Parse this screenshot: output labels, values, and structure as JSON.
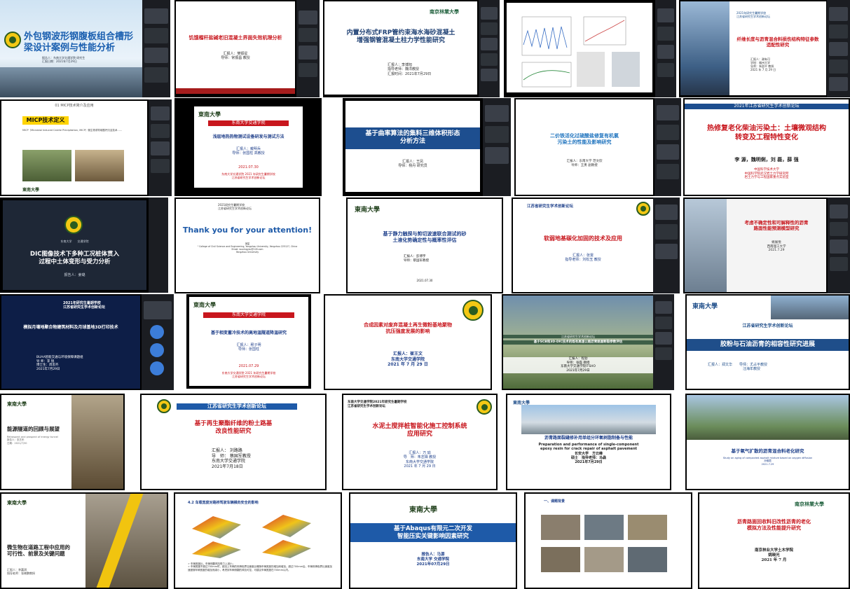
{
  "tiles": [
    {
      "title": "外包钢波形钢腹板组合槽形\n梁设计案例与性能分析",
      "sub": "报告人：东南大学交通学院 研究生\n汇报日期：2021年7月29日"
    },
    {
      "title": "饥饿榴杆盐碱老旧混凝土界面失效机理分析",
      "sub": "汇报人：樊振星\n导师：常振昌 教授"
    },
    {
      "title": "内置分布式FRP管约束海水海砂混凝土\n增强钢管混凝土柱力学性能研究",
      "sub": "汇报人：李博旭\n指导老师：魏洋教授\n汇报时间：2021年7月29日"
    },
    {
      "title": "",
      "sub": ""
    },
    {
      "title": "纤维长度与沥青混合料损伤结构特征参数\n适配性研究",
      "sub": "汇报人：谢有可\n学校：福州大学\n导师：朱劭平 教授\n2021 年 7 月 29 日",
      "head": "2021年研究生暑期学校\n江苏省研究生学术创新论坛"
    },
    {
      "title": "MICP技术定义",
      "sub": "01 MICP技术简介及应用",
      "body": "MICP（Microbial Induced Calcite Precipitation, MICP）微生物诱导碳酸钙沉淀技术……"
    },
    {
      "title": "浅层地热热物测试设备研发与测试方法",
      "sub": "汇报人：戴明兵\n导师：张国柱 高教授",
      "date": "2021.07.30",
      "org": "东南大学交通学院 2021 年研究生暑期学校\n江苏省研究生学术创新论坛",
      "head": "东南大学交通学院"
    },
    {
      "title": "基于曲率算法的集料三维体积形态\n分析方法",
      "sub": "汇报人：王凤\n导师：杨丹 研究员"
    },
    {
      "title": "二价铁活化过硫酸盐修复有机氯\n污染土的性能及影响研究",
      "sub": "汇报人：东南大学 范文欣\n导师：王勇 副教授"
    },
    {
      "title": "热修复老化柴油污染土：土壤微观结构\n转变及工程特性变化",
      "sub": "李 源，魏明俐，刘 磊，薛 强",
      "org": "中国科学技术大学\n中国科学院武汉岩土力学研究所\n岩土力学与工程国家重点实验室",
      "head": "2021年江苏省研究生学术创新论坛"
    },
    {
      "title": "DIC图像技术下多种工况桩体贯入\n过程中土体变形与受力分析",
      "sub": "报告人：姜璐",
      "head": "东南大学　　交通学院"
    },
    {
      "title": "Thank you for your attention!",
      "sub": "吴星\n¹ College of Civil Science and Engineering, Yangzhou University, Yangzhou 225127, China\nEmail: wuxingyzu@126.com\nYangzhou University",
      "head": "2021研究生暑期学校\n江苏省研究生学术创新论坛"
    },
    {
      "title": "基于静力触探与剪切波速联合测试的砂\n土液化势确定性与概率性评估",
      "sub": "汇报人：彭博宇\n导师：蔡国军教授",
      "date": "2021.07.30"
    },
    {
      "title": "软弱地基碳化加固的技术及应用",
      "sub": "汇报人：张雯\n指导老师：刘松玉 教授",
      "head": "江苏省研究生学术创新论坛"
    },
    {
      "title": "考虑不确定性和可解释性的沥青\n路面性能预测模型研究",
      "sub": "姚展悦\n西南理工大学\n2021.7.29"
    },
    {
      "title": "模拟月壤地聚合物建筑材料及月球基地3D打印技术",
      "sub": "BUAA智能交通与环境保障课题组\n导 师：李 锐\n博士生：周思齐\n2021年7月29日",
      "head": "2021年研究生暑期学校\n江苏省研究生学术创新论坛"
    },
    {
      "title": "基于相变蓄冷技术的高地温隧道降温研究",
      "sub": "汇报人：穆子明\n导师：张国柱",
      "date": "2021.07.29",
      "org": "东南大学交通学院 2021 年研究生暑期学校\n江苏省研究生学术创新论坛",
      "head": "东南大学交通学院"
    },
    {
      "title": "合成因素对废弃混凝土再生微粉基地聚物\n抗压强度发展的影响",
      "sub": "汇报人：崔王文\n东南大学交通学院\n2021 年 7 月 29 日"
    },
    {
      "title": "基于SCB和3D-DIC技术的既有高速公路沥青路面断裂参数评估",
      "sub": "汇报人：程劲\n导师：张磊 教授\n东南大学交通学院ITSHO\n2021年7月29日",
      "head": "江苏省研究生学术创新论坛"
    },
    {
      "title": "胶粉与石油沥青的相容性研究进展",
      "sub": "汇报人：郑文华　　导师：尤占平教授\n　　　　　　　　　　汪海年教授",
      "head": "江苏省研究生学术创新论坛"
    },
    {
      "title": "能源隧道的回顾与展望",
      "sub": "Retrospect and prospect of energy tunnel\n报告人：张艺彤\n日期：2021/7/30"
    },
    {
      "title": "基于再生聚酯纤维的粉土路基\n改良性能研究",
      "sub": "汇报人：  刘路路\n导　师：  蔡国军教授\n东南大学交通学院\n2021年7月18日",
      "head": "江苏省研究生学术创新论坛"
    },
    {
      "title": "水泥土搅拌桩智能化施工控制系统\n应用研究",
      "sub": "汇报人：万 瑜\n导　师：朱志铎 教授\n东南大学交通学院\n2021 年 7 月 29 日",
      "head": "东南大学交通学院2021年研究生暑期学校\n江苏省研究生学术创新论坛"
    },
    {
      "title": "沥青路面裂缝修补用单组分环氧树脂制备与性能",
      "sub": "Preparation and performance of single-component\nepoxy resin for crack repair of asphalt pavement\n长安大学　方云峰\n硕士　指导老师：马骉\n2021年7月29日"
    },
    {
      "title": "基于氧气扩散的沥青混合料老化研究",
      "sub": "Study on aging of compacted asphalt mixture based on oxygen diffusion\n孙骊君\n2021.7.29"
    },
    {
      "title": "微生物在道路工程中应用的\n可行性、前景及关键问题",
      "sub": "汇报人：李嘉琪\n指导老师：张晓鹏教授"
    },
    {
      "title": "4.2 车载宽度对路桥驾驶车辆横向安全的影响",
      "sub": "➢ 车辆宽度比，车辆侧翻风险势力上减小；\n➢ 车辆宽度不超过700mm时，超出上车辆的侧滑临界加速度比略随车辆宽度的增加而增加。超过700mm后，车辆侧滑临界比速度加速度随车辆宽度的增加而减小，考虑到车辆侧翻的风险可控，可建议车辆宽度在700mm以内。"
    },
    {
      "title": "基于Abaqus有限元二次开发\n智能压实关键影响因素研究",
      "sub": "报告人：马源\n东南大学 交通学院\n2021年07月29日"
    },
    {
      "title": "一、课题背景",
      "sub": ""
    },
    {
      "title": "沥青路面回收料旧改性沥青的老化\n模拟方法及性能提升研究",
      "sub": "南京林业大学土木学院\n姚晓光\n2021 年 7 月",
      "head": "南京林業大學"
    }
  ],
  "seu_logo_text": "東南大學",
  "seu_logo_text2": "東南大學",
  "njfu_text": "南京林業大學"
}
